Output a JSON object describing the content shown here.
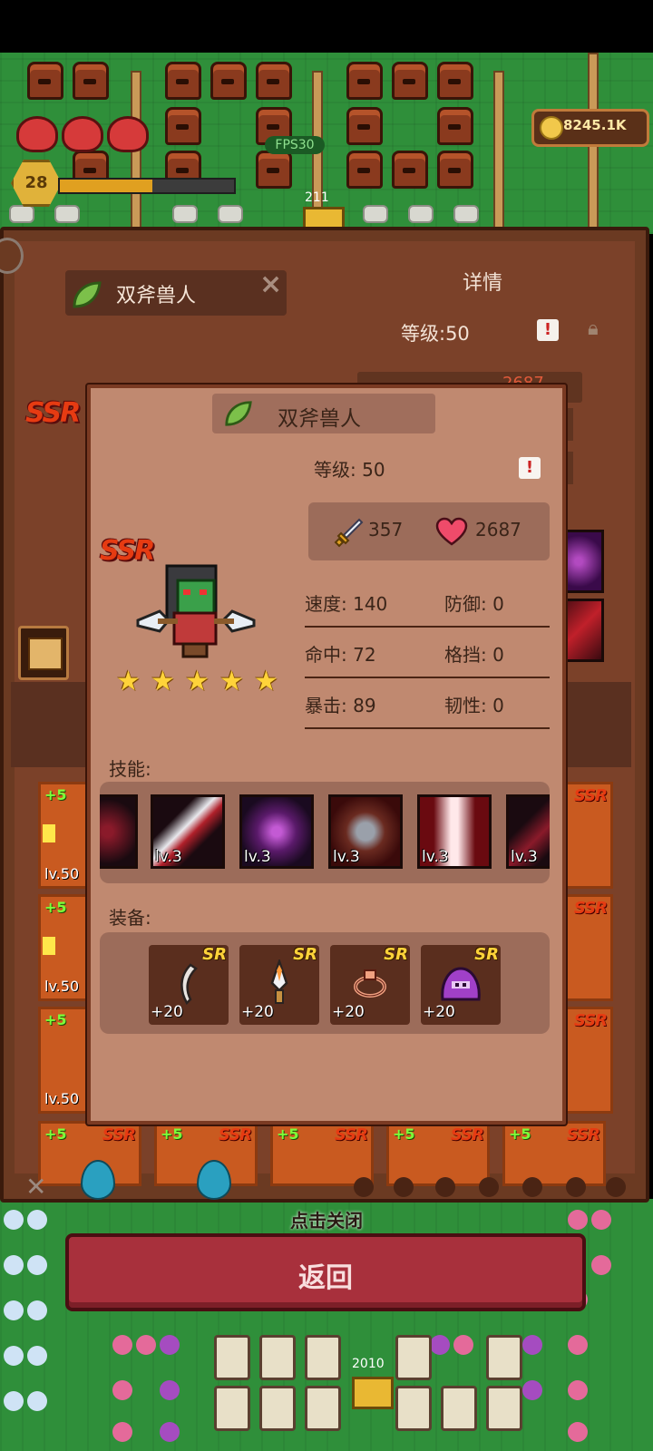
{
  "hud": {
    "fps": "FPS30",
    "player_level": "28",
    "xp_fraction": 0.53,
    "gold": "8245.1K",
    "chest_count_top": "211",
    "chest_count_bottom": "2010"
  },
  "background_panel": {
    "hero_name": "双斧兽人",
    "details_title": "详情",
    "level_text": "等级:50",
    "hp_preview": "2687",
    "rarity": "SSR"
  },
  "popup": {
    "hero_name": "双斧兽人",
    "level_text": "等级: 50",
    "rarity": "SSR",
    "stars": 5,
    "attack": "357",
    "hp": "2687",
    "stats": [
      {
        "a": "速度: 140",
        "b": "防御: 0"
      },
      {
        "a": "命中: 72",
        "b": "格挡: 0"
      },
      {
        "a": "暴击: 89",
        "b": "韧性: 0"
      }
    ],
    "skills_label": "技能:",
    "skills": [
      {
        "icon": "scythe-skill-icon",
        "level": ""
      },
      {
        "icon": "bloody-blade-skill-icon",
        "level": "lv.3"
      },
      {
        "icon": "purple-vortex-skill-icon",
        "level": "lv.3"
      },
      {
        "icon": "shield-bell-skill-icon",
        "level": "lv.3"
      },
      {
        "icon": "blood-pillar-skill-icon",
        "level": "lv.3"
      },
      {
        "icon": "dark-claw-skill-icon",
        "level": "lv.3"
      }
    ],
    "equipment_label": "装备:",
    "equipment": [
      {
        "icon": "bone-blade-icon",
        "rarity": "SR",
        "bonus": "+20"
      },
      {
        "icon": "dagger-icon",
        "rarity": "SR",
        "bonus": "+20"
      },
      {
        "icon": "ring-icon",
        "rarity": "SR",
        "bonus": "+20"
      },
      {
        "icon": "purple-slime-icon",
        "rarity": "SR",
        "bonus": "+20"
      }
    ]
  },
  "cards_left": [
    {
      "plus": "+5",
      "level": "lv.50"
    },
    {
      "plus": "+5",
      "level": "lv.50"
    },
    {
      "plus": "+5",
      "level": "lv.50"
    }
  ],
  "cards_bottom": [
    {
      "plus": "+5",
      "rarity": "SSR"
    },
    {
      "plus": "+5",
      "rarity": "SSR"
    },
    {
      "plus": "+5",
      "rarity": "SSR"
    },
    {
      "plus": "+5",
      "rarity": "SSR"
    },
    {
      "plus": "+5",
      "rarity": "SSR"
    }
  ],
  "cards_right_rarity": [
    "SSR",
    "SSR",
    "SSR"
  ],
  "tap_to_close": "点击关闭",
  "back_button": "返回",
  "colors": {
    "panel": "#6b3a22",
    "popup": "#c08970",
    "back_button": "#a8303c",
    "ssr_red": "#e63b12",
    "sr_gold": "#ffd33a"
  }
}
